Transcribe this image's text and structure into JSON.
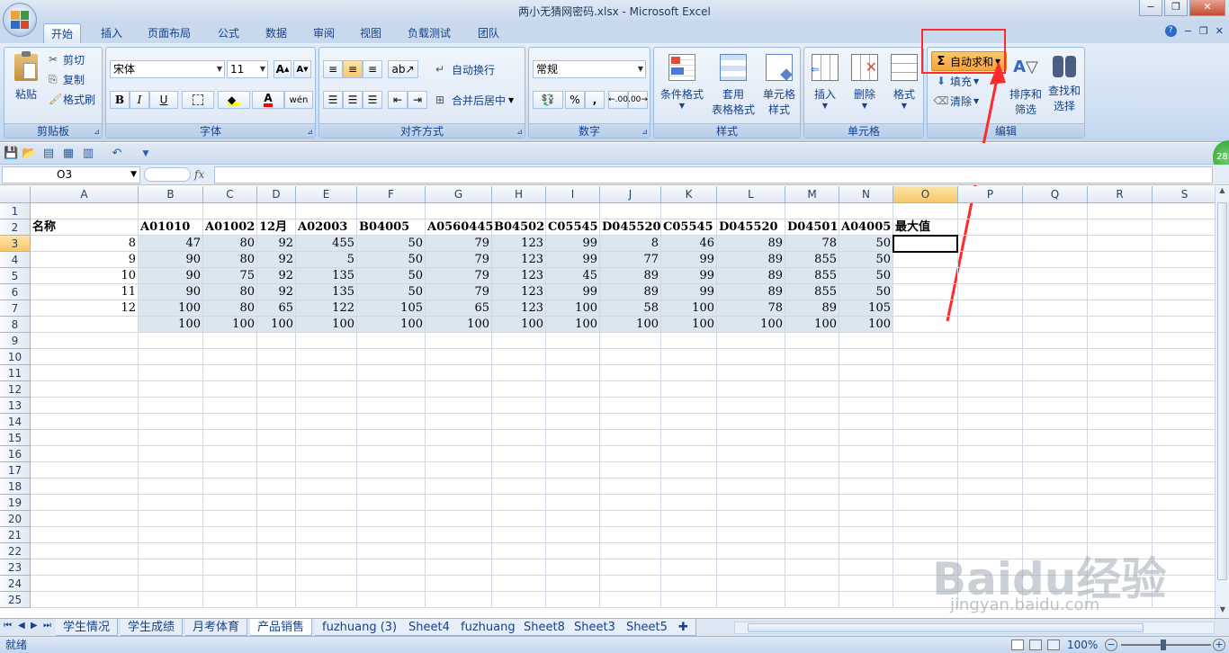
{
  "window": {
    "title": "两小无猜网密码.xlsx - Microsoft Excel",
    "minimize": "−",
    "restore": "❐",
    "close": "✕"
  },
  "ribbon_tabs": [
    "开始",
    "插入",
    "页面布局",
    "公式",
    "数据",
    "审阅",
    "视图",
    "负载测试",
    "团队"
  ],
  "ribbon": {
    "clipboard": {
      "label": "剪贴板",
      "paste": "粘贴",
      "cut": "剪切",
      "copy": "复制",
      "format_painter": "格式刷"
    },
    "font": {
      "label": "字体",
      "font_name": "宋体",
      "font_size": "11",
      "bold": "B",
      "italic": "I",
      "underline": "U",
      "grow": "A",
      "shrink": "A",
      "fill_color": "#ffff00",
      "font_color": "#ff0000"
    },
    "alignment": {
      "label": "对齐方式",
      "wrap_text": "自动换行",
      "merge_center": "合并后居中"
    },
    "number": {
      "label": "数字",
      "format": "常规",
      "percent": "%",
      "comma": ",",
      "inc_dec": "←.00",
      "dec_dec": ".00→"
    },
    "styles": {
      "label": "样式",
      "conditional": "条件格式",
      "table_1": "套用",
      "table_2": "表格格式",
      "cell_style_1": "单元格",
      "cell_style_2": "样式"
    },
    "cells": {
      "label": "单元格",
      "insert": "插入",
      "delete": "删除",
      "format": "格式"
    },
    "editing": {
      "label": "编辑",
      "autosum": "自动求和",
      "fill": "填充",
      "clear": "清除",
      "sort_1": "排序和",
      "sort_2": "筛选",
      "find_1": "查找和",
      "find_2": "选择"
    }
  },
  "formula_bar": {
    "name_box": "O3",
    "fx": "fx",
    "value": ""
  },
  "columns": [
    "A",
    "B",
    "C",
    "D",
    "E",
    "F",
    "G",
    "H",
    "I",
    "J",
    "K",
    "L",
    "M",
    "N",
    "O",
    "P",
    "Q",
    "R",
    "S"
  ],
  "rows": [
    "1",
    "2",
    "3",
    "4",
    "5",
    "6",
    "7",
    "8",
    "9",
    "10",
    "11",
    "12",
    "13",
    "14",
    "15",
    "16",
    "17",
    "18",
    "19",
    "20",
    "21",
    "22",
    "23",
    "24",
    "25"
  ],
  "sheet": {
    "row2": [
      "名称",
      "A01010",
      "A01002",
      "12月",
      "A02003",
      "B04005",
      "A0560445",
      "B04502",
      "C05545",
      "D045520",
      "C05545",
      "D045520",
      "D04501",
      "A04005",
      "最大值"
    ],
    "data_rows": [
      [
        "8",
        "47",
        "80",
        "92",
        "455",
        "50",
        "79",
        "123",
        "99",
        "8",
        "46",
        "89",
        "78",
        "50"
      ],
      [
        "9",
        "90",
        "80",
        "92",
        "5",
        "50",
        "79",
        "123",
        "99",
        "77",
        "99",
        "89",
        "855",
        "50"
      ],
      [
        "10",
        "90",
        "75",
        "92",
        "135",
        "50",
        "79",
        "123",
        "45",
        "89",
        "99",
        "89",
        "855",
        "50"
      ],
      [
        "11",
        "90",
        "80",
        "92",
        "135",
        "50",
        "79",
        "123",
        "99",
        "89",
        "99",
        "89",
        "855",
        "50"
      ],
      [
        "12",
        "100",
        "80",
        "65",
        "122",
        "105",
        "65",
        "123",
        "100",
        "58",
        "100",
        "78",
        "89",
        "105"
      ],
      [
        "",
        "100",
        "100",
        "100",
        "100",
        "100",
        "100",
        "100",
        "100",
        "100",
        "100",
        "100",
        "100",
        "100"
      ]
    ]
  },
  "sheet_tabs": [
    "学生情况",
    "学生成绩",
    "月考体育",
    "产品销售",
    "fuzhuang (3)",
    "Sheet4",
    "fuzhuang",
    "Sheet8",
    "Sheet3",
    "Sheet5"
  ],
  "active_sheet": "产品销售",
  "status": {
    "ready": "就绪",
    "zoom": "100%"
  },
  "watermark": {
    "brand": "Baidu经验",
    "url": "jingyan.baidu.com"
  },
  "badge": "28"
}
